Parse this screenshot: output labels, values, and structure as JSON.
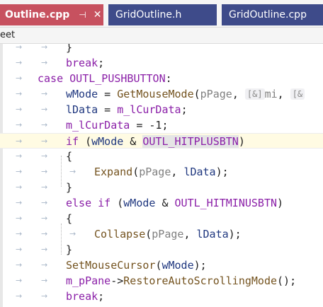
{
  "tabs": [
    {
      "label": "Outline.cpp",
      "pin": "⊣",
      "close": "✕",
      "active": true
    },
    {
      "label": "GridOutline.h",
      "active": false
    },
    {
      "label": "GridOutline.cpp",
      "active": false
    }
  ],
  "navbar": {
    "text": "eet"
  },
  "code": {
    "l0": {
      "t1": "}"
    },
    "l1": {
      "t1": "break",
      "t2": ";"
    },
    "l2": {
      "t1": "case",
      "t2": "OUTL_PUSHBUTTON",
      "t3": ":"
    },
    "l3": {
      "t1": "wMode",
      "t2": " = ",
      "t3": "GetMouseMode",
      "t4": "(",
      "t5": "pPage",
      "t6": ", ",
      "hint": "[&]",
      "t7": "mi",
      "t8": ", ",
      "hint2": "[&"
    },
    "l4": {
      "t1": "lData",
      "t2": " = ",
      "t3": "m_lCurData",
      "t4": ";"
    },
    "l5": {
      "t1": "m_lCurData",
      "t2": " = -1;"
    },
    "l6": {
      "t1": "if",
      "t2": " (",
      "t3": "wMode",
      "t4": " & ",
      "t5": "OUTL_HITPLUSBTN",
      "t6": ")"
    },
    "l7": {
      "t1": "{"
    },
    "l8": {
      "t1": "Expand",
      "t2": "(",
      "t3": "pPage",
      "t4": ", ",
      "t5": "lData",
      "t6": ");"
    },
    "l9": {
      "t1": "}"
    },
    "l10": {
      "t1": "else",
      "t2": " ",
      "t3": "if",
      "t4": " (",
      "t5": "wMode",
      "t6": " & ",
      "t7": "OUTL_HITMINUSBTN",
      "t8": ")"
    },
    "l11": {
      "t1": "{"
    },
    "l12": {
      "t1": "Collapse",
      "t2": "(",
      "t3": "pPage",
      "t4": ", ",
      "t5": "lData",
      "t6": ");"
    },
    "l13": {
      "t1": "}"
    },
    "l14": {
      "t1": "SetMouseCursor",
      "t2": "(",
      "t3": "wMode",
      "t4": ");"
    },
    "l15": {
      "t1": "m_pPane",
      "t2": "->",
      "t3": "RestoreAutoScrollingMode",
      "t4": "();"
    },
    "l16": {
      "t1": "break",
      "t2": ";"
    }
  },
  "colors": {
    "active_tab": "#c7515f",
    "inactive_tab": "#3e4b8a",
    "keyword": "#8b20a8",
    "function": "#74531f",
    "variable": "#1f377f",
    "current_line": "#fffbe3"
  }
}
